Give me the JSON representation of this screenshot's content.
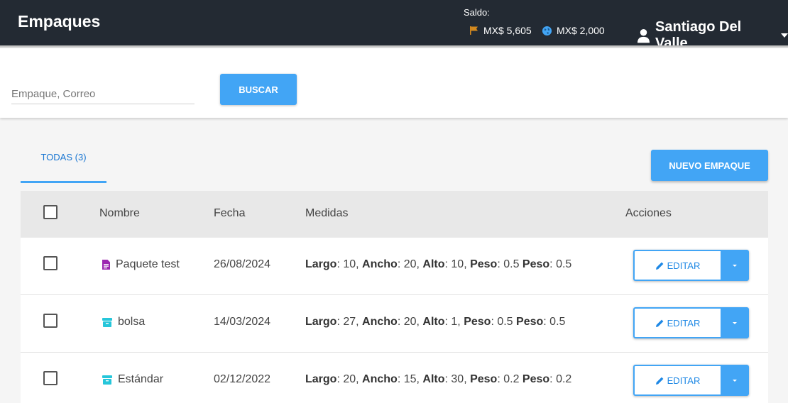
{
  "header": {
    "title": "Empaques",
    "saldo_label": "Saldo:",
    "balance_1": "MX$ 5,605",
    "balance_2": "MX$ 2,000",
    "user_name": "Santiago Del Valle"
  },
  "search": {
    "placeholder": "Empaque, Correo",
    "value": "",
    "button_label": "BUSCAR"
  },
  "tabs": [
    {
      "label": "TODAS (3)",
      "active": true
    }
  ],
  "new_button_label": "NUEVO EMPAQUE",
  "table": {
    "columns": [
      "Nombre",
      "Fecha",
      "Medidas",
      "Acciones"
    ],
    "rows": [
      {
        "icon": "document-icon",
        "name": "Paquete test",
        "date": "26/08/2024",
        "largo": "10",
        "ancho": "20",
        "alto": "10",
        "peso": "0.5",
        "peso2": "0.5",
        "edit_label": "EDITAR"
      },
      {
        "icon": "box-icon",
        "name": "bolsa",
        "date": "14/03/2024",
        "largo": "27",
        "ancho": "20",
        "alto": "1",
        "peso": "0.5",
        "peso2": "0.5",
        "edit_label": "EDITAR"
      },
      {
        "icon": "box-icon",
        "name": "Estándar",
        "date": "02/12/2022",
        "largo": "20",
        "ancho": "15",
        "alto": "30",
        "peso": "0.2",
        "peso2": "0.2",
        "edit_label": "EDITAR"
      }
    ],
    "measure_labels": {
      "largo": "Largo",
      "ancho": "Ancho",
      "alto": "Alto",
      "peso": "Peso"
    }
  },
  "colors": {
    "header_bg": "#232a33",
    "accent": "#42a5f5",
    "document_icon": "#9c27b0",
    "box_icon": "#26c6da",
    "flag_icon": "#d4891e",
    "globe_icon": "#42a5f5"
  }
}
